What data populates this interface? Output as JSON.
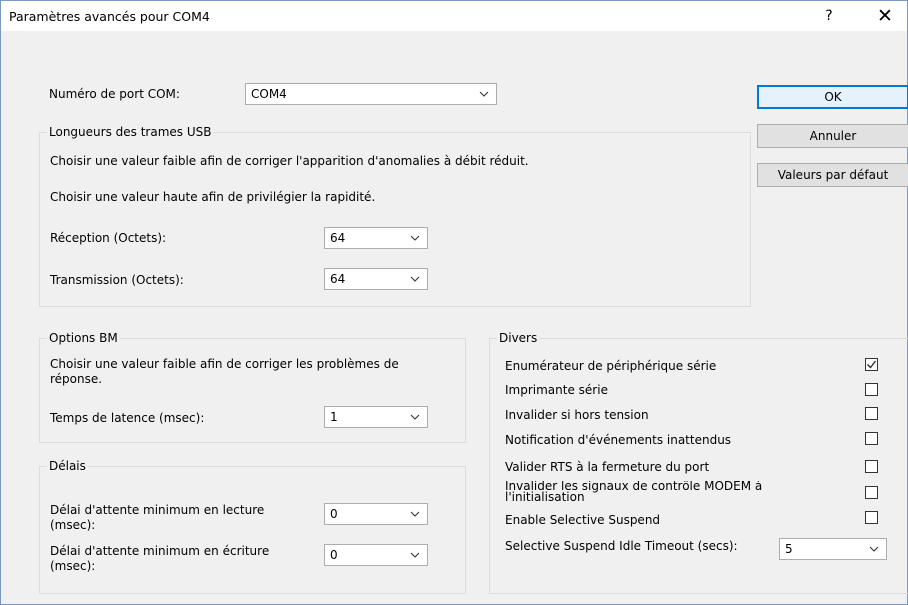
{
  "window": {
    "title": "Paramètres avancés pour COM4",
    "help_glyph": "?",
    "close_glyph": "✕"
  },
  "port": {
    "label": "Numéro de port COM:",
    "value": "COM4"
  },
  "buttons": {
    "ok": "OK",
    "cancel": "Annuler",
    "defaults": "Valeurs par défaut"
  },
  "usb": {
    "legend": "Longueurs des trames USB",
    "hint_low": "Choisir une valeur faible afin de corriger  l'apparition d'anomalies à débit réduit.",
    "hint_high": "Choisir une valeur haute afin de privilégier la rapidité.",
    "rx_label": "Réception (Octets):",
    "rx_value": "64",
    "tx_label": "Transmission (Octets):",
    "tx_value": "64"
  },
  "bm": {
    "legend": "Options BM",
    "hint": "Choisir une valeur faible afin de corriger les problèmes de réponse.",
    "latency_label": "Temps de latence (msec):",
    "latency_value": "1"
  },
  "timeouts": {
    "legend": "Délais",
    "read_label": "Délai d'attente minimum en lecture (msec):",
    "read_value": "0",
    "write_label": "Délai d'attente minimum en écriture (msec):",
    "write_value": "0"
  },
  "misc": {
    "legend": "Divers",
    "options": [
      {
        "label": "Enumérateur de périphérique série",
        "checked": true
      },
      {
        "label": "Imprimante série",
        "checked": false
      },
      {
        "label": "Invalider si hors tension",
        "checked": false
      },
      {
        "label": "Notification d'événements inattendus",
        "checked": false
      },
      {
        "label": "Valider RTS à la fermeture du port",
        "checked": false
      },
      {
        "label": "Invalider les signaux de contrôle MODEM à l'initialisation",
        "checked": false
      },
      {
        "label": "Enable Selective Suspend",
        "checked": false
      }
    ],
    "idle_label": "Selective Suspend Idle Timeout (secs):",
    "idle_value": "5"
  },
  "colors": {
    "accent": "#0078d7",
    "window_bg": "#f0f0f0",
    "group_border": "#dcdcdc"
  }
}
